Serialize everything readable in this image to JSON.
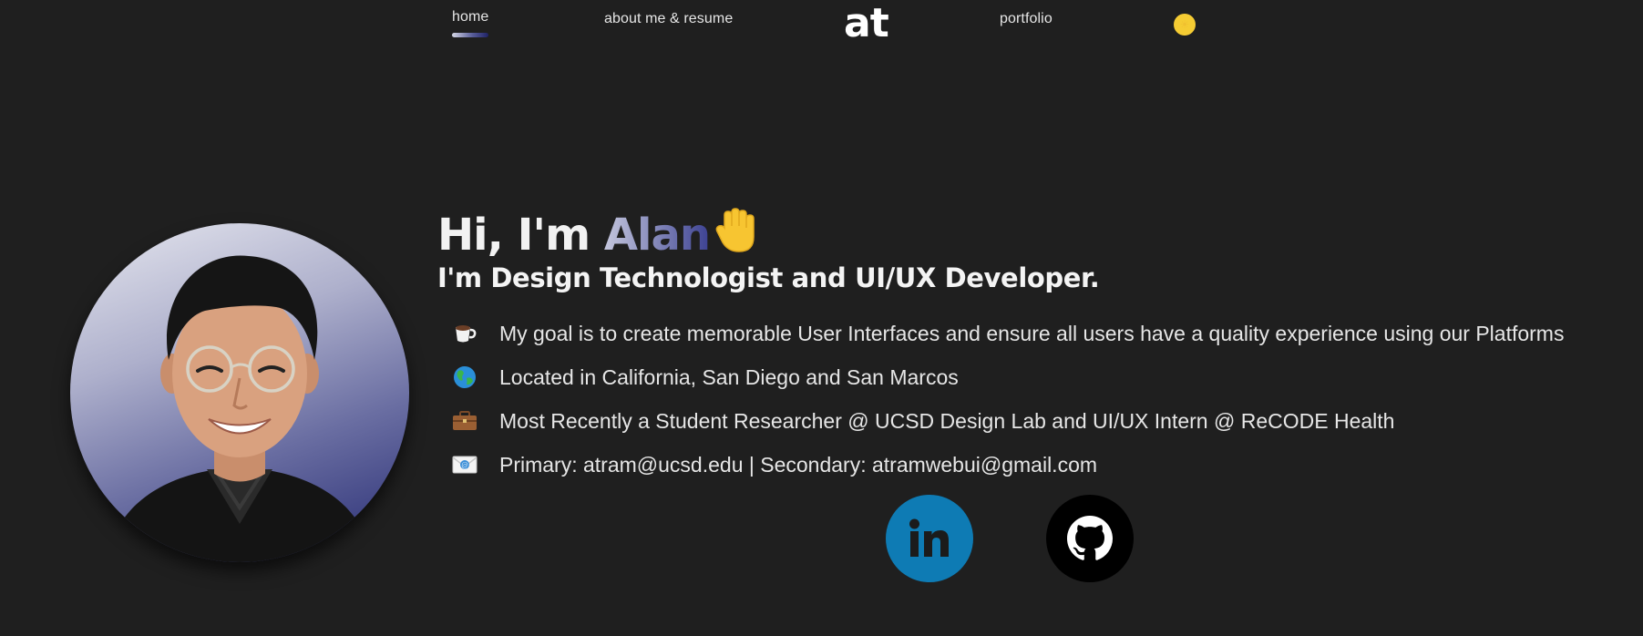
{
  "nav": {
    "home": "home",
    "about": "about me & resume",
    "logo": "at",
    "portfolio": "portfolio",
    "theme_icon": "sun-icon"
  },
  "hero": {
    "greeting_prefix": "Hi, I'm ",
    "name": "Alan",
    "wave_icon": "waving-hand-icon",
    "subtitle": "I'm Design Technologist and UI/UX Developer."
  },
  "info": [
    {
      "icon": "coffee-icon",
      "text": "My goal is to create memorable User Interfaces and ensure all users have a quality experience using our Platforms"
    },
    {
      "icon": "globe-icon",
      "text": "Located in California, San Diego and San Marcos"
    },
    {
      "icon": "briefcase-icon",
      "text": "Most Recently a Student Researcher @ UCSD Design Lab and UI/UX Intern @ ReCODE Health"
    },
    {
      "icon": "email-icon",
      "text": "Primary: atram@ucsd.edu | Secondary: atramwebui@gmail.com"
    }
  ],
  "social": {
    "linkedin_icon": "linkedin-icon",
    "linkedin_color": "#0e7bb4",
    "github_icon": "github-icon",
    "github_color": "#000000"
  },
  "colors": {
    "background": "#1f1f1f",
    "text": "#e8e8e8",
    "accent_gradient_start": "#c4c6dd",
    "accent_gradient_end": "#1e2266",
    "theme_toggle": "#f5cc33"
  }
}
